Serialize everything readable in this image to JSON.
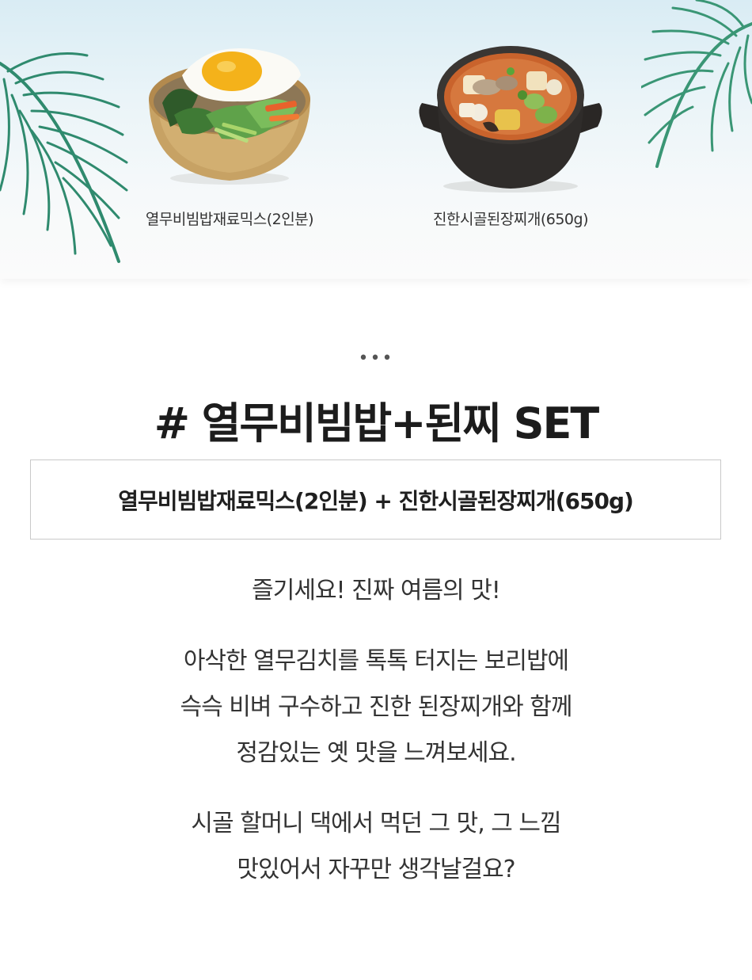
{
  "products": [
    {
      "name": "열무비빔밥재료믹스(2인분)",
      "image": "bibimbap-bowl"
    },
    {
      "name": "진한시골된장찌개(650g)",
      "image": "doenjang-stew-pot"
    }
  ],
  "divider": "•••",
  "title": "# 열무비빔밥+된찌 SET",
  "subtitle": "열무비빔밥재료믹스(2인분) + 진한시골된장찌개(650g)",
  "paragraphs": [
    [
      "즐기세요! 진짜 여름의 맛!"
    ],
    [
      "아삭한 열무김치를 톡톡 터지는 보리밥에",
      "슥슥 비벼 구수하고 진한 된장찌개와 함께",
      "정감있는 옛 맛을 느껴보세요."
    ],
    [
      "시골 할머니 댁에서 먹던 그 맛, 그 느낌",
      "맛있어서 자꾸만 생각날걸요?"
    ]
  ],
  "colors": {
    "leaf": "#3f9a7a",
    "text": "#333333",
    "border": "#c9c9c9"
  }
}
